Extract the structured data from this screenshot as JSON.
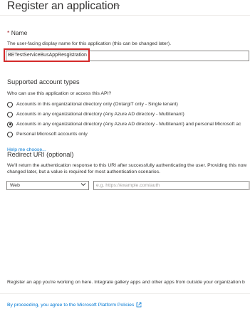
{
  "header": {
    "title": "Register an application",
    "more_label": "···"
  },
  "name_section": {
    "required_mark": "*",
    "label": "Name",
    "helper": "The user-facing display name for this application (this can be changed later).",
    "value": "BETestServiceBusAppResgistration"
  },
  "account_types": {
    "heading": "Supported account types",
    "question": "Who can use this application or access this API?",
    "options": [
      {
        "label": "Accounts in this organizational directory only (OntargiT only - Single tenant)",
        "selected": false
      },
      {
        "label": "Accounts in any organizational directory (Any Azure AD directory - Multitenant)",
        "selected": false
      },
      {
        "label": "Accounts in any organizational directory (Any Azure AD directory - Multitenant) and personal Microsoft ac",
        "selected": true
      },
      {
        "label": "Personal Microsoft accounts only",
        "selected": false
      }
    ],
    "help_link": "Help me choose..."
  },
  "redirect": {
    "heading": "Redirect URI (optional)",
    "description_line1": "We'll return the authentication response to this URI after successfully authenticating the user. Providing this now",
    "description_line2": "changed later, but a value is required for most authentication scenarios.",
    "platform_value": "Web",
    "uri_placeholder": "e.g. https://example.com/auth"
  },
  "footer": {
    "note": "Register an app you're working on here. Integrate gallery apps and other apps from outside your organization b",
    "policy_text": "By proceeding, you agree to the Microsoft Platform Policies",
    "external_icon": "external-link-icon"
  },
  "colors": {
    "accent": "#0078d4",
    "highlight": "#d42b2b",
    "required": "#a4262c"
  }
}
